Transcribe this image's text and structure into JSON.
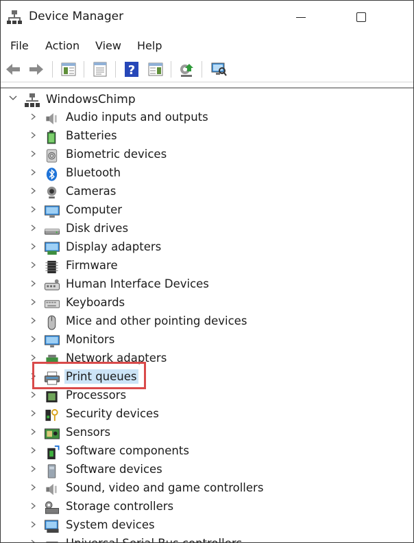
{
  "window": {
    "title": "Device Manager"
  },
  "menu": [
    "File",
    "Action",
    "View",
    "Help"
  ],
  "toolbar": {
    "buttons": [
      "back-icon",
      "forward-icon",
      "show-hide-console-tree-icon",
      "properties-icon",
      "help-icon",
      "action-pane-icon",
      "update-driver-icon",
      "scan-hardware-icon"
    ]
  },
  "tree": {
    "root": "WindowsChimp",
    "items": [
      "Audio inputs and outputs",
      "Batteries",
      "Biometric devices",
      "Bluetooth",
      "Cameras",
      "Computer",
      "Disk drives",
      "Display adapters",
      "Firmware",
      "Human Interface Devices",
      "Keyboards",
      "Mice and other pointing devices",
      "Monitors",
      "Network adapters",
      "Print queues",
      "Processors",
      "Security devices",
      "Sensors",
      "Software components",
      "Software devices",
      "Sound, video and game controllers",
      "Storage controllers",
      "System devices",
      "Universal Serial Bus controllers"
    ],
    "selected": "Print queues"
  },
  "colors": {
    "selection": "#cce4f7",
    "highlight": "#d94a4a",
    "accent": "#1e73d8"
  }
}
